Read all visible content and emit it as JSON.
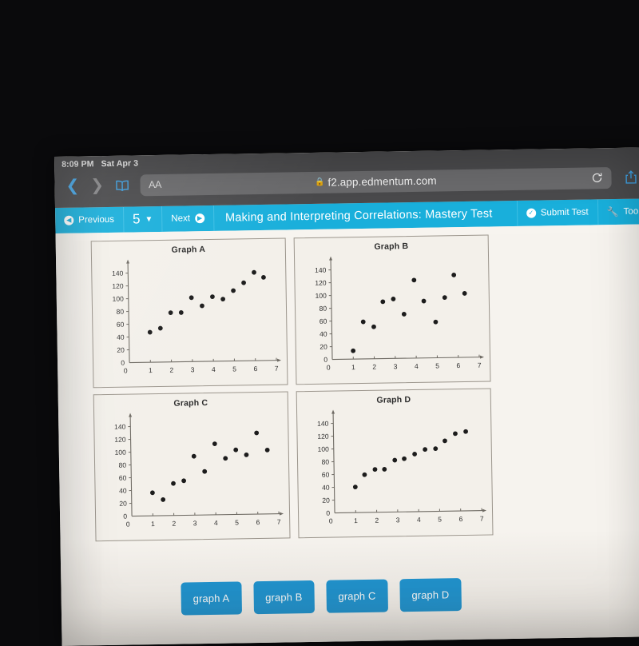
{
  "status_bar": {
    "time": "8:09 PM",
    "date": "Sat Apr 3"
  },
  "browser": {
    "back_icon": "chevron-left-icon",
    "forward_icon": "chevron-right-icon",
    "bookmarks_icon": "book-icon",
    "text_size_label": "AA",
    "lock_icon": "lock-icon",
    "url": "f2.app.edmentum.com",
    "reload_icon": "reload-icon",
    "share_icon": "share-icon"
  },
  "toolbar": {
    "previous_label": "Previous",
    "question_number": "5",
    "next_label": "Next",
    "title": "Making and Interpreting Correlations: Mastery Test",
    "submit_label": "Submit Test",
    "tools_label": "Too",
    "accent_color": "#19afdb"
  },
  "answers": [
    {
      "label": "graph A"
    },
    {
      "label": "graph B"
    },
    {
      "label": "graph C"
    },
    {
      "label": "graph D"
    }
  ],
  "answer_color": "#1c94d2",
  "chart_data": [
    {
      "type": "scatter",
      "title": "Graph A",
      "xlabel": "",
      "ylabel": "",
      "xlim": [
        0,
        7
      ],
      "ylim": [
        0,
        155
      ],
      "xticks": [
        0,
        1,
        2,
        3,
        4,
        5,
        6,
        7
      ],
      "yticks": [
        0,
        20,
        40,
        60,
        80,
        100,
        120,
        140
      ],
      "grid": false,
      "legend": "none",
      "point_color": "#1c1c1c",
      "x": [
        1.0,
        1.5,
        2.0,
        2.5,
        3.0,
        3.5,
        4.0,
        4.5,
        5.0,
        5.5,
        6.0,
        6.45
      ],
      "y": [
        47,
        53,
        77,
        77,
        100,
        87,
        101,
        97,
        110,
        122,
        138,
        130
      ]
    },
    {
      "type": "scatter",
      "title": "Graph B",
      "xlabel": "",
      "ylabel": "",
      "xlim": [
        0,
        7
      ],
      "ylim": [
        0,
        155
      ],
      "xticks": [
        0,
        1,
        2,
        3,
        4,
        5,
        6,
        7
      ],
      "yticks": [
        0,
        20,
        40,
        60,
        80,
        100,
        120,
        140
      ],
      "grid": false,
      "legend": "none",
      "point_color": "#1c1c1c",
      "x": [
        1.0,
        1.5,
        2.0,
        2.45,
        2.95,
        3.45,
        3.95,
        4.4,
        4.95,
        5.4,
        5.85,
        6.35
      ],
      "y": [
        13,
        58,
        50,
        89,
        93,
        69,
        122,
        89,
        56,
        94,
        129,
        100
      ]
    },
    {
      "type": "scatter",
      "title": "Graph C",
      "xlabel": "",
      "ylabel": "",
      "xlim": [
        0,
        7
      ],
      "ylim": [
        0,
        155
      ],
      "xticks": [
        0,
        1,
        2,
        3,
        4,
        5,
        6,
        7
      ],
      "yticks": [
        0,
        20,
        40,
        60,
        80,
        100,
        120,
        140
      ],
      "grid": false,
      "legend": "none",
      "point_color": "#1c1c1c",
      "x": [
        1.0,
        1.5,
        2.0,
        2.5,
        3.0,
        3.5,
        4.0,
        4.5,
        5.0,
        5.5,
        6.0,
        6.5
      ],
      "y": [
        36,
        25,
        50,
        54,
        92,
        68,
        111,
        88,
        101,
        93,
        127,
        100
      ]
    },
    {
      "type": "scatter",
      "title": "Graph D",
      "xlabel": "",
      "ylabel": "",
      "xlim": [
        0,
        7
      ],
      "ylim": [
        0,
        155
      ],
      "xticks": [
        0,
        1,
        2,
        3,
        4,
        5,
        6,
        7
      ],
      "yticks": [
        0,
        20,
        40,
        60,
        80,
        100,
        120,
        140
      ],
      "grid": false,
      "legend": "none",
      "point_color": "#1c1c1c",
      "x": [
        1.0,
        1.45,
        1.95,
        2.4,
        2.9,
        3.35,
        3.85,
        4.35,
        4.85,
        5.3,
        5.8,
        6.3
      ],
      "y": [
        40,
        59,
        67,
        67,
        81,
        83,
        90,
        97,
        98,
        110,
        121,
        124
      ]
    }
  ]
}
